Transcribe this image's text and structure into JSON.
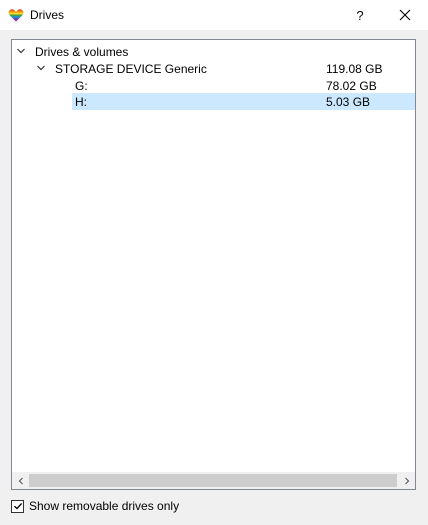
{
  "window": {
    "title": "Drives",
    "help_label": "?",
    "close_icon": "close-icon",
    "app_icon": "rainbow-heart-icon"
  },
  "tree": {
    "root": {
      "label": "Drives & volumes",
      "expanded": true
    },
    "device": {
      "label": "STORAGE DEVICE Generic",
      "size": "119.08 GB",
      "expanded": true
    },
    "volumes": [
      {
        "label": "G:",
        "size": "78.02 GB",
        "selected": false
      },
      {
        "label": "H:",
        "size": "5.03 GB",
        "selected": true
      }
    ]
  },
  "options": {
    "removable_only_label": "Show removable drives only",
    "removable_only_checked": true
  },
  "colors": {
    "selection": "#cce8ff",
    "border": "#828790",
    "dialog_bg": "#f0f0f0"
  }
}
